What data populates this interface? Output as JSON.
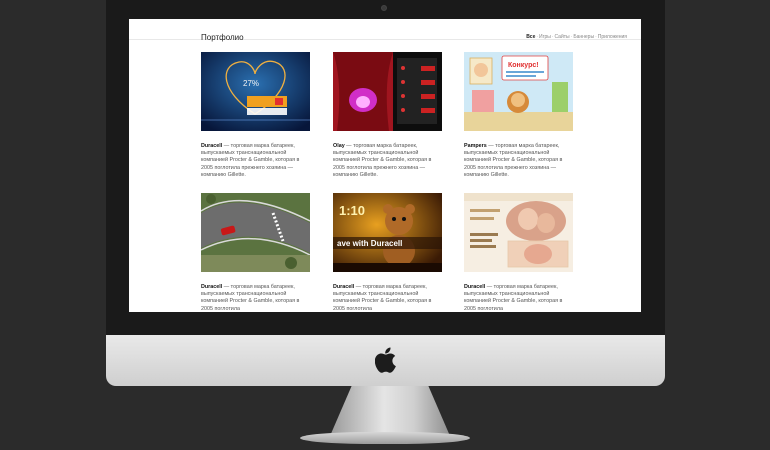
{
  "portfolio": {
    "title": "Портфолио",
    "filters": [
      "Все",
      "Игры",
      "Сайты",
      "Баннеры",
      "Приложения"
    ]
  },
  "cards": [
    {
      "brand": "Duracell",
      "text": " — торговая марка батареек, выпускаемых транснациональной компанией Procter & Gamble, которая в 2005 поглотила прежнего хозяина — компанию Gillette."
    },
    {
      "brand": "Olay",
      "text": " — торговая марка батареек, выпускаемых транснациональной компанией Procter & Gamble, которая в 2005 поглотила прежнего хозяина — компанию Gillette."
    },
    {
      "brand": "Pampers",
      "text": " — торговая марка батареек, выпускаемых транснациональной компанией Procter & Gamble, которая в 2005 поглотила прежнего хозяина — компанию Gillette."
    },
    {
      "brand": "Duracell",
      "text": " — торговая марка батареек, выпускаемых транснациональной компанией Procter & Gamble, которая в 2005 поглотила"
    },
    {
      "brand": "Duracell",
      "text": " — торговая марка батареек, выпускаемых транснациональной компанией Procter & Gamble, которая в 2005 поглотила"
    },
    {
      "brand": "Duracell",
      "text": " — торговая марка батареек, выпускаемых транснациональной компанией Procter & Gamble, которая в 2005 поглотила"
    }
  ],
  "thumbs": {
    "t1": {
      "percent": "27%"
    },
    "t3": {
      "headline": "Конкурс!"
    },
    "t5": {
      "score": "1:10",
      "slogan": "ave with Duracell"
    }
  },
  "colors": {
    "screen_bg": "#ffffff",
    "desktop_bg": "#2b2b2b"
  }
}
